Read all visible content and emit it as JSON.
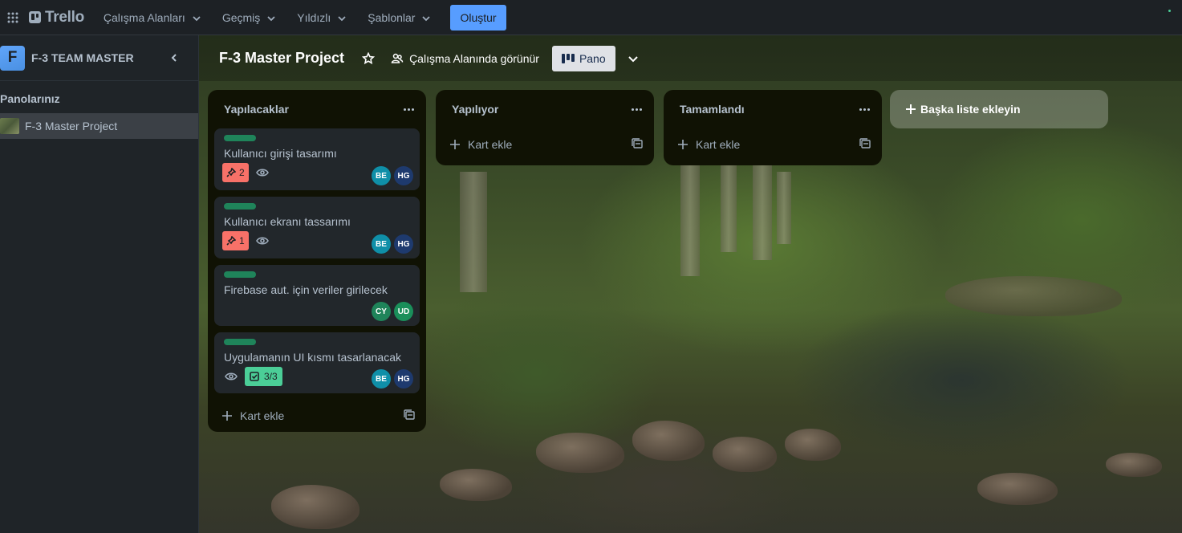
{
  "topbar": {
    "logo_text": "Trello",
    "nav": [
      {
        "label": "Çalışma Alanları"
      },
      {
        "label": "Geçmiş"
      },
      {
        "label": "Yıldızlı"
      },
      {
        "label": "Şablonlar"
      }
    ],
    "create_label": "Oluştur"
  },
  "sidebar": {
    "workspace_initial": "F",
    "workspace_name": "F-3 TEAM MASTER",
    "section_title": "Panolarınız",
    "boards": [
      {
        "name": "F-3 Master Project"
      }
    ]
  },
  "board": {
    "title": "F-3 Master Project",
    "visibility": "Çalışma Alanında görünür",
    "view_label": "Pano",
    "add_list_label": "Başka liste ekleyin",
    "add_card_label": "Kart ekle",
    "lists": [
      {
        "title": "Yapılacaklar",
        "cards": [
          {
            "title": "Kullanıcı girişi tasarımı",
            "due_count": "2",
            "members": [
              "BE",
              "HG"
            ]
          },
          {
            "title": "Kullanıcı ekranı tassarımı",
            "due_count": "1",
            "members": [
              "BE",
              "HG"
            ]
          },
          {
            "title": "Firebase aut. için veriler girilecek",
            "members": [
              "CY",
              "UD"
            ]
          },
          {
            "title": "Uygulamanın UI kısmı tasarlanacak",
            "checklist": "3/3",
            "members": [
              "BE",
              "HG"
            ]
          }
        ]
      },
      {
        "title": "Yapılıyor",
        "cards": []
      },
      {
        "title": "Tamamlandı",
        "cards": []
      }
    ]
  },
  "colors": {
    "accent": "#579dff",
    "label_green": "#1f845a",
    "due_red": "#f87168",
    "checklist_green": "#4bce97",
    "avatar_be": "#0f8fa8",
    "avatar_hg": "#1e3a6e",
    "avatar_cy": "#1f845a",
    "avatar_ud": "#1a8f5a"
  }
}
